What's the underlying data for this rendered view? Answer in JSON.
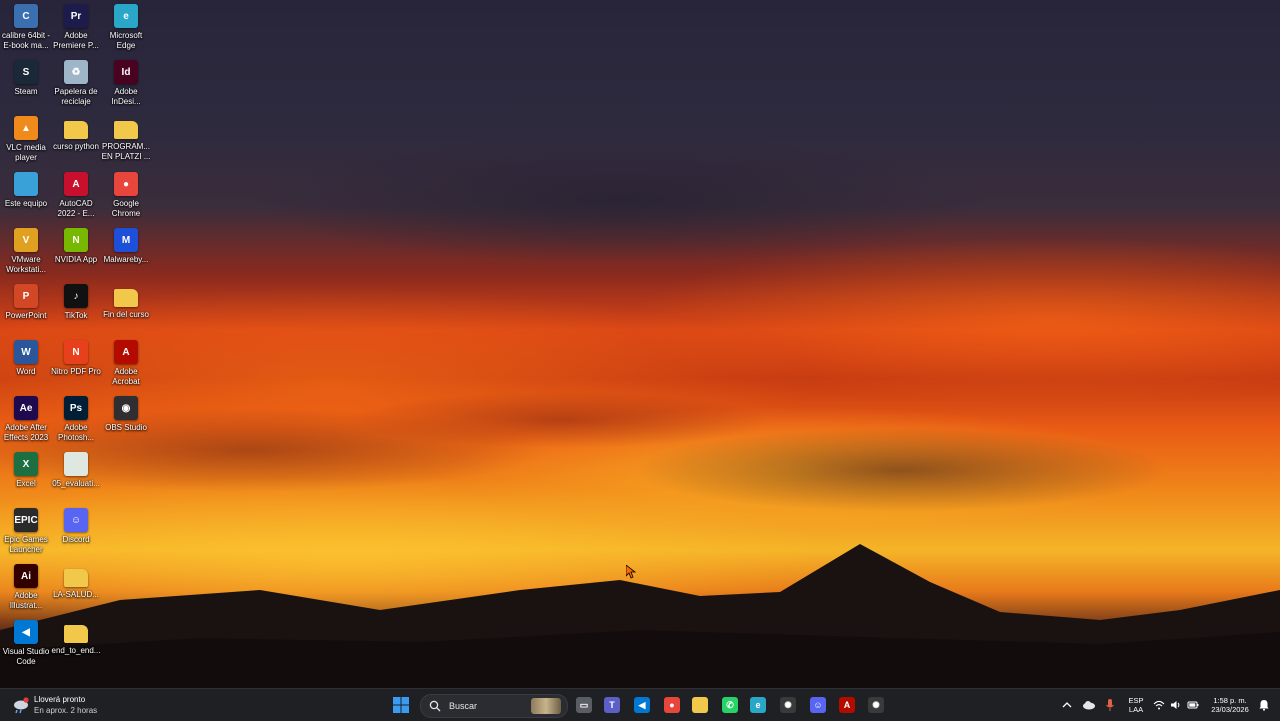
{
  "desktop": {
    "icons": [
      {
        "label": "calibre 64bit -\nE-book ma...",
        "icon": "calibre-icon",
        "color": "#3a6fb0",
        "glyph": "C"
      },
      {
        "label": "Adobe\nPremiere P...",
        "icon": "premiere-icon",
        "color": "#1d1b4b",
        "glyph": "Pr"
      },
      {
        "label": "Microsoft\nEdge",
        "icon": "edge-icon",
        "color": "#2aa6c9",
        "glyph": "e"
      },
      {
        "label": "Steam",
        "icon": "steam-icon",
        "color": "#1b2838",
        "glyph": "S"
      },
      {
        "label": "Papelera de\nreciclaje",
        "icon": "recycle-bin-icon",
        "color": "#9fb6c9",
        "glyph": "♻"
      },
      {
        "label": "Adobe\nInDesi...",
        "icon": "indesign-icon",
        "color": "#49021f",
        "glyph": "Id"
      },
      {
        "label": "VLC media\nplayer",
        "icon": "vlc-icon",
        "color": "#f08a1a",
        "glyph": "▲"
      },
      {
        "label": "curso python",
        "icon": "folder-icon",
        "color": "#f2c84b",
        "glyph": ""
      },
      {
        "label": "PROGRAM...\nEN PLATZI ...",
        "icon": "folder-icon",
        "color": "#f2c84b",
        "glyph": ""
      },
      {
        "label": "Este equipo",
        "icon": "computer-icon",
        "color": "#3aa0d8",
        "glyph": ""
      },
      {
        "label": "AutoCAD\n2022 - E...",
        "icon": "autocad-icon",
        "color": "#c8102e",
        "glyph": "A"
      },
      {
        "label": "Google\nChrome",
        "icon": "chrome-icon",
        "color": "#e8453c",
        "glyph": "●"
      },
      {
        "label": "VMware\nWorkstati...",
        "icon": "vmware-icon",
        "color": "#e0a020",
        "glyph": "V"
      },
      {
        "label": "NVIDIA App",
        "icon": "nvidia-icon",
        "color": "#76b900",
        "glyph": "N"
      },
      {
        "label": "Malwareby...",
        "icon": "malwarebytes-icon",
        "color": "#1e4fd8",
        "glyph": "M"
      },
      {
        "label": "PowerPoint",
        "icon": "powerpoint-icon",
        "color": "#d24726",
        "glyph": "P"
      },
      {
        "label": "TikTok",
        "icon": "tiktok-icon",
        "color": "#111111",
        "glyph": "♪"
      },
      {
        "label": "Fin del curso",
        "icon": "folder-icon",
        "color": "#f2c84b",
        "glyph": ""
      },
      {
        "label": "Word",
        "icon": "word-icon",
        "color": "#2b579a",
        "glyph": "W"
      },
      {
        "label": "Nitro PDF Pro",
        "icon": "nitro-pdf-icon",
        "color": "#e8401c",
        "glyph": "N"
      },
      {
        "label": "Adobe\nAcrobat",
        "icon": "acrobat-icon",
        "color": "#b30b00",
        "glyph": "A"
      },
      {
        "label": "Adobe After\nEffects 2023",
        "icon": "after-effects-icon",
        "color": "#1f0a4f",
        "glyph": "Ae"
      },
      {
        "label": "Adobe\nPhotosh...",
        "icon": "photoshop-icon",
        "color": "#001e36",
        "glyph": "Ps"
      },
      {
        "label": "OBS Studio",
        "icon": "obs-icon",
        "color": "#302e31",
        "glyph": "◉"
      },
      {
        "label": "Excel",
        "icon": "excel-icon",
        "color": "#1d6f42",
        "glyph": "X"
      },
      {
        "label": "05_evaluati...",
        "icon": "document-icon",
        "color": "#dfe8e0",
        "glyph": ""
      },
      {
        "label": "",
        "icon": "blank",
        "color": "transparent",
        "glyph": ""
      },
      {
        "label": "Epic Games\nLauncher",
        "icon": "epic-games-icon",
        "color": "#2a2a2a",
        "glyph": "EPIC"
      },
      {
        "label": "Discord",
        "icon": "discord-icon",
        "color": "#5865f2",
        "glyph": "☺"
      },
      {
        "label": "",
        "icon": "blank",
        "color": "transparent",
        "glyph": ""
      },
      {
        "label": "Adobe\nIllustrat...",
        "icon": "illustrator-icon",
        "color": "#330000",
        "glyph": "Ai"
      },
      {
        "label": "LA-SALUD...",
        "icon": "folder-icon",
        "color": "#f2c84b",
        "glyph": ""
      },
      {
        "label": "",
        "icon": "blank",
        "color": "transparent",
        "glyph": ""
      },
      {
        "label": "Visual Studio\nCode",
        "icon": "vscode-icon",
        "color": "#0078d4",
        "glyph": "◀"
      },
      {
        "label": "end_to_end...",
        "icon": "folder-icon",
        "color": "#f2c84b",
        "glyph": ""
      },
      {
        "label": "",
        "icon": "blank",
        "color": "transparent",
        "glyph": ""
      }
    ]
  },
  "taskbar": {
    "weather": {
      "title": "Lloverá pronto",
      "subtitle": "En aprox. 2 horas"
    },
    "search_placeholder": "Buscar",
    "apps": [
      {
        "name": "start-button",
        "icon": "windows-icon",
        "color": "#3a8ee6",
        "glyph": "⊞"
      },
      {
        "name": "taskview-button",
        "icon": "task-view-icon",
        "color": "#5a5d66",
        "glyph": "▭"
      },
      {
        "name": "taskbar-teams",
        "icon": "teams-icon",
        "color": "#5b5fc7",
        "glyph": "T"
      },
      {
        "name": "taskbar-vscode",
        "icon": "vscode-icon",
        "color": "#0078d4",
        "glyph": "◀"
      },
      {
        "name": "taskbar-chrome",
        "icon": "chrome-icon",
        "color": "#e8453c",
        "glyph": "●"
      },
      {
        "name": "taskbar-explorer",
        "icon": "folder-icon",
        "color": "#f2c84b",
        "glyph": ""
      },
      {
        "name": "taskbar-whatsapp",
        "icon": "whatsapp-icon",
        "color": "#25d366",
        "glyph": "✆"
      },
      {
        "name": "taskbar-edge",
        "icon": "edge-icon",
        "color": "#2aa6c9",
        "glyph": "e"
      },
      {
        "name": "taskbar-chatgpt",
        "icon": "chatgpt-icon",
        "color": "#3a3a3a",
        "glyph": "✺"
      },
      {
        "name": "taskbar-discord",
        "icon": "discord-icon",
        "color": "#5865f2",
        "glyph": "☺"
      },
      {
        "name": "taskbar-acrobat",
        "icon": "acrobat-icon",
        "color": "#b30b00",
        "glyph": "A"
      },
      {
        "name": "taskbar-chatgpt-2",
        "icon": "chatgpt-icon",
        "color": "#3a3a3a",
        "glyph": "✺"
      }
    ],
    "tray": {
      "language_top": "ESP",
      "language_bottom": "LAA",
      "time": "1:58 p. m.",
      "date": "23/03/2026"
    }
  }
}
